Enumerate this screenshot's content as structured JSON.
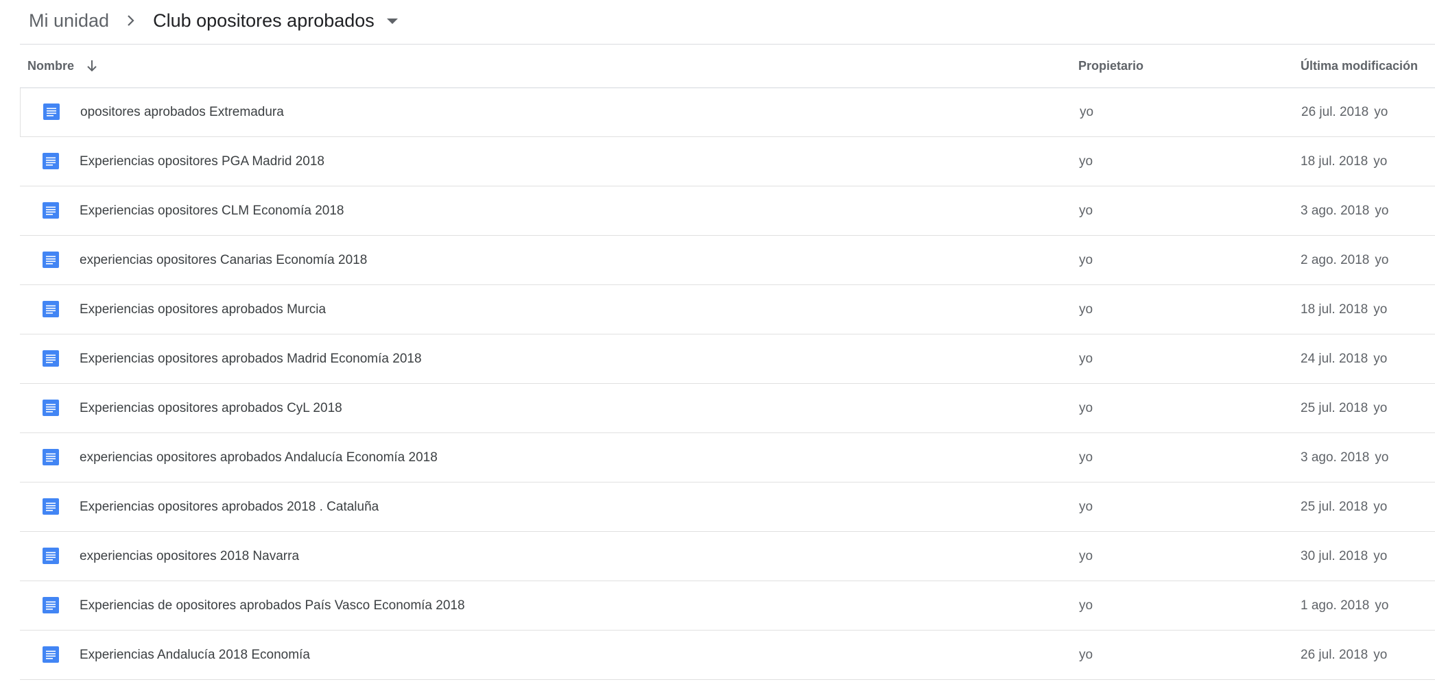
{
  "breadcrumb": {
    "root": "Mi unidad",
    "separator_icon": "chevron-right-icon",
    "current": "Club opositores aprobados",
    "current_menu_icon": "caret-down-icon"
  },
  "table": {
    "columns": {
      "name": "Nombre",
      "owner": "Propietario",
      "modified": "Última modificación"
    },
    "sort": {
      "column": "name",
      "direction": "descending",
      "icon": "arrow-down-icon"
    },
    "file_icon": "google-docs-icon",
    "accent_color": "#4285f4",
    "rows": [
      {
        "name": "opositores aprobados Extremadura",
        "owner": "yo",
        "modified_date": "26 jul. 2018",
        "modified_by": "yo"
      },
      {
        "name": "Experiencias opositores PGA Madrid 2018",
        "owner": "yo",
        "modified_date": "18 jul. 2018",
        "modified_by": "yo"
      },
      {
        "name": "Experiencias opositores CLM Economía 2018",
        "owner": "yo",
        "modified_date": "3 ago. 2018",
        "modified_by": "yo"
      },
      {
        "name": "experiencias opositores Canarias Economía 2018",
        "owner": "yo",
        "modified_date": "2 ago. 2018",
        "modified_by": "yo"
      },
      {
        "name": "Experiencias opositores aprobados Murcia",
        "owner": "yo",
        "modified_date": "18 jul. 2018",
        "modified_by": "yo"
      },
      {
        "name": "Experiencias opositores aprobados Madrid Economía 2018",
        "owner": "yo",
        "modified_date": "24 jul. 2018",
        "modified_by": "yo"
      },
      {
        "name": "Experiencias opositores aprobados CyL 2018",
        "owner": "yo",
        "modified_date": "25 jul. 2018",
        "modified_by": "yo"
      },
      {
        "name": "experiencias opositores aprobados Andalucía Economía 2018",
        "owner": "yo",
        "modified_date": "3 ago. 2018",
        "modified_by": "yo"
      },
      {
        "name": "Experiencias opositores aprobados 2018 . Cataluña",
        "owner": "yo",
        "modified_date": "25 jul. 2018",
        "modified_by": "yo"
      },
      {
        "name": "experiencias opositores 2018 Navarra",
        "owner": "yo",
        "modified_date": "30 jul. 2018",
        "modified_by": "yo"
      },
      {
        "name": "Experiencias de opositores aprobados País Vasco Economía 2018",
        "owner": "yo",
        "modified_date": "1 ago. 2018",
        "modified_by": "yo"
      },
      {
        "name": "Experiencias Andalucía 2018 Economía",
        "owner": "yo",
        "modified_date": "26 jul. 2018",
        "modified_by": "yo"
      }
    ]
  }
}
